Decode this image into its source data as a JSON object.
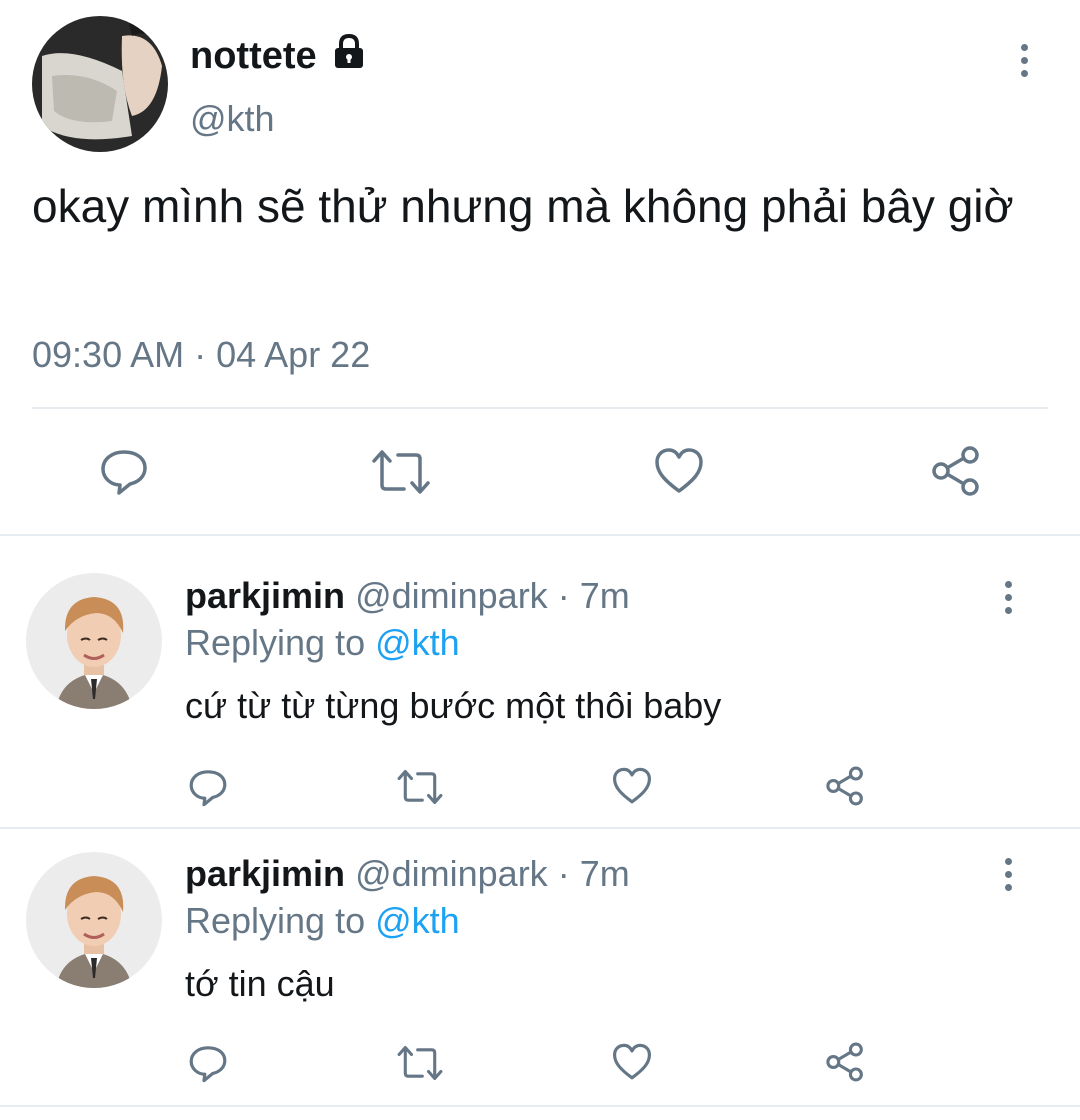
{
  "main_tweet": {
    "display_name": "nottete",
    "handle": "@kth",
    "text": "okay mình sẽ thử nhưng mà không phải bây giờ",
    "timestamp": "09:30 AM · 04 Apr 22",
    "protected_icon": "lock-icon",
    "actions": [
      "reply-icon",
      "retweet-icon",
      "like-icon",
      "share-icon"
    ]
  },
  "replies": [
    {
      "display_name": "parkjimin",
      "handle": "@diminpark",
      "time": "· 7m",
      "replying_label": "Replying to",
      "replying_handle": "@kth",
      "text": "cứ từ từ từng bước một thôi baby"
    },
    {
      "display_name": "parkjimin",
      "handle": "@diminpark",
      "time": "· 7m",
      "replying_label": "Replying to",
      "replying_handle": "@kth",
      "text": "tớ tin cậu"
    }
  ],
  "colors": {
    "text": "#14171a",
    "secondary": "#657786",
    "link": "#1da1f2",
    "divider": "#e6ecf0"
  }
}
